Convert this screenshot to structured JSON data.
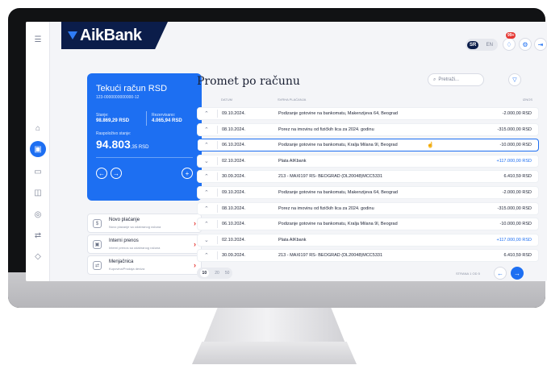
{
  "header": {
    "brand": "AikBank",
    "lang_active": "SR",
    "lang_inactive": "EN",
    "notif_count": "99+"
  },
  "account": {
    "title": "Tekući račun RSD",
    "number": "123-0000000000000-12",
    "stanje_label": "Stanje:",
    "stanje_value": "98.869,29 RSD",
    "rezervisano_label": "Rezervisano:",
    "rezervisano_value": "4.065,94 RSD",
    "raspolozivo_label": "Raspoloživo stanje:",
    "balance_main": "94.803",
    "balance_suffix": ",35 RSD"
  },
  "quick_actions": [
    {
      "title": "Novo plaćanje",
      "subtitle": "Novo plaćanje sa odabranog računa"
    },
    {
      "title": "Interni prenos",
      "subtitle": "Interni prenos sa odabranog računa"
    },
    {
      "title": "Menjačnica",
      "subtitle": "Kupovina/Prodaja deviza"
    }
  ],
  "transactions": {
    "title": "Promet po računu",
    "search_placeholder": "Pretraži...",
    "col_date": "DATUM",
    "col_purpose": "SVRHA PLAĆANJA",
    "col_amount": "IZNOS",
    "rows": [
      {
        "chevron": "^",
        "date": "09.10.2024.",
        "purpose": "Podizanje gotovine na bankomatu, Makenzijeva 64, Beograd",
        "amount": "-2.000,00 RSD",
        "positive": false
      },
      {
        "chevron": "^",
        "date": "08.10.2024.",
        "purpose": "Porez na imovinu od fizičkih lica za 2024. godinu",
        "amount": "-315.000,00 RSD",
        "positive": false
      },
      {
        "chevron": "^",
        "date": "06.10.2024.",
        "purpose": "Podizanje gotovine na bankomatu, Kralja Milana 9I, Beograd",
        "amount": "-10.000,00 RSD",
        "positive": false
      },
      {
        "chevron": "v",
        "date": "02.10.2024.",
        "purpose": "Plata AIKbank",
        "amount": "+117.000,00 RSD",
        "positive": true
      },
      {
        "chevron": "^",
        "date": "30.09.2024.",
        "purpose": "213 - MAXI197 RS- BEOGRAD (DL20048)MCC5331",
        "amount": "6.410,59 RSD",
        "positive": false
      },
      {
        "chevron": "^",
        "date": "09.10.2024.",
        "purpose": "Podizanje gotovine na bankomatu, Makenzijeva 64, Beograd",
        "amount": "-2.000,00 RSD",
        "positive": false
      },
      {
        "chevron": "^",
        "date": "08.10.2024.",
        "purpose": "Porez na imovinu od fizičkih lica za 2024. godinu",
        "amount": "-315.000,00 RSD",
        "positive": false
      },
      {
        "chevron": "^",
        "date": "06.10.2024.",
        "purpose": "Podizanje gotovine na bankomatu, Kralja Milana 9I, Beograd",
        "amount": "-10.000,00 RSD",
        "positive": false
      },
      {
        "chevron": "v",
        "date": "02.10.2024.",
        "purpose": "Plata AIKbank",
        "amount": "+117.000,00 RSD",
        "positive": true
      },
      {
        "chevron": "^",
        "date": "30.09.2024.",
        "purpose": "213 - MAXI197 RS- BEOGRAD (DL20048)MCC5331",
        "amount": "6.410,59 RSD",
        "positive": false
      }
    ],
    "page_sizes": [
      "10",
      "20",
      "50"
    ],
    "page_info": "STRANA 1 OD 5"
  },
  "colors": {
    "accent": "#1d6ff2",
    "navy": "#0b1d4a",
    "danger": "#e53935"
  },
  "icons": [
    "menu-icon",
    "home-icon",
    "card-icon",
    "wallet-icon",
    "folder-icon",
    "settings-icon",
    "transfer-icon",
    "tag-icon",
    "bell-icon",
    "gear-icon",
    "logout-icon",
    "search-icon",
    "filter-icon"
  ]
}
